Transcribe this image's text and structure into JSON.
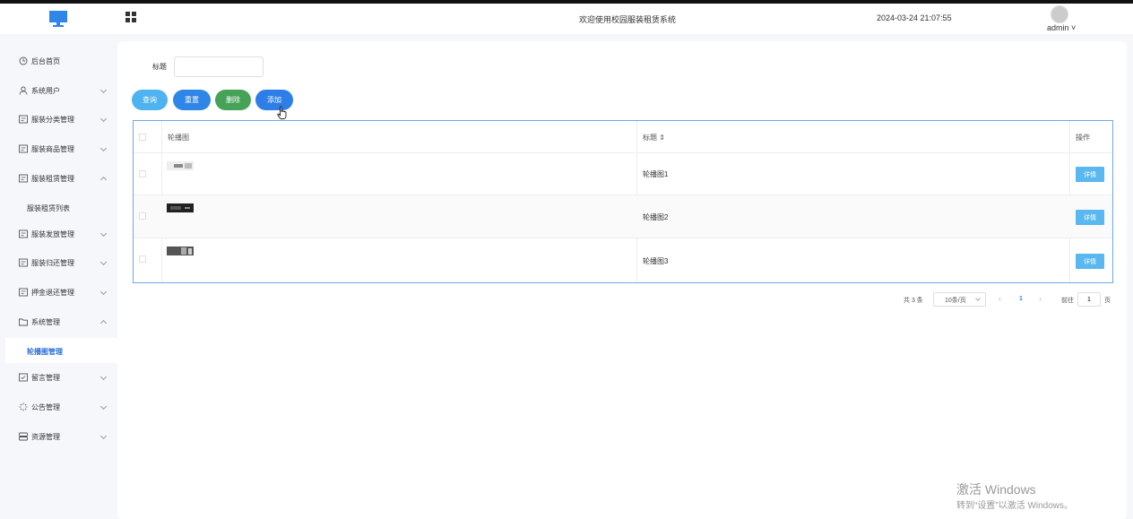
{
  "header": {
    "title": "欢迎使用校园服装租赁系统",
    "datetime": "2024-03-24 21:07:55",
    "user": "admin ˅"
  },
  "sidebar": {
    "items": [
      {
        "label": "后台首页",
        "icon": "clock-icon"
      },
      {
        "label": "系统用户",
        "icon": "user-icon"
      },
      {
        "label": "服装分类管理",
        "icon": "list-icon"
      },
      {
        "label": "服装商品管理",
        "icon": "list-icon"
      },
      {
        "label": "服装租赁管理",
        "icon": "list-icon"
      },
      {
        "label": "服装租赁列表",
        "icon": ""
      },
      {
        "label": "服装发放管理",
        "icon": "list-icon"
      },
      {
        "label": "服装归还管理",
        "icon": "list-icon"
      },
      {
        "label": "押金退还管理",
        "icon": "list-icon"
      },
      {
        "label": "系统管理",
        "icon": "folder-icon"
      },
      {
        "label": "轮播图管理",
        "icon": ""
      },
      {
        "label": "留言管理",
        "icon": "message-icon"
      },
      {
        "label": "公告管理",
        "icon": "loading-icon"
      },
      {
        "label": "资源管理",
        "icon": "server-icon"
      }
    ]
  },
  "search": {
    "label": "标题",
    "value": "",
    "placeholder": ""
  },
  "buttons": {
    "query": "查询",
    "reset": "重置",
    "delete": "删除",
    "add": "添加"
  },
  "table": {
    "columns": [
      "轮播图",
      "标题 ⇕",
      "操作"
    ],
    "rows": [
      {
        "title": "轮播图1",
        "action": "详情"
      },
      {
        "title": "轮播图2",
        "action": "详情"
      },
      {
        "title": "轮播图3",
        "action": "详情"
      }
    ]
  },
  "pagination": {
    "total": "共 3 条",
    "page_size": "10条/页",
    "prev": "‹",
    "current": "1",
    "next": "›",
    "goto_label": "前往",
    "goto_value": "1",
    "page_suffix": "页"
  },
  "watermark": {
    "line1": "激活 Windows",
    "line2": "转到“设置”以激活 Windows。"
  },
  "colors": {
    "accent": "#2e86e6",
    "query": "#4fb3f0",
    "delete": "#45a256",
    "detail": "#5ab8f0"
  }
}
